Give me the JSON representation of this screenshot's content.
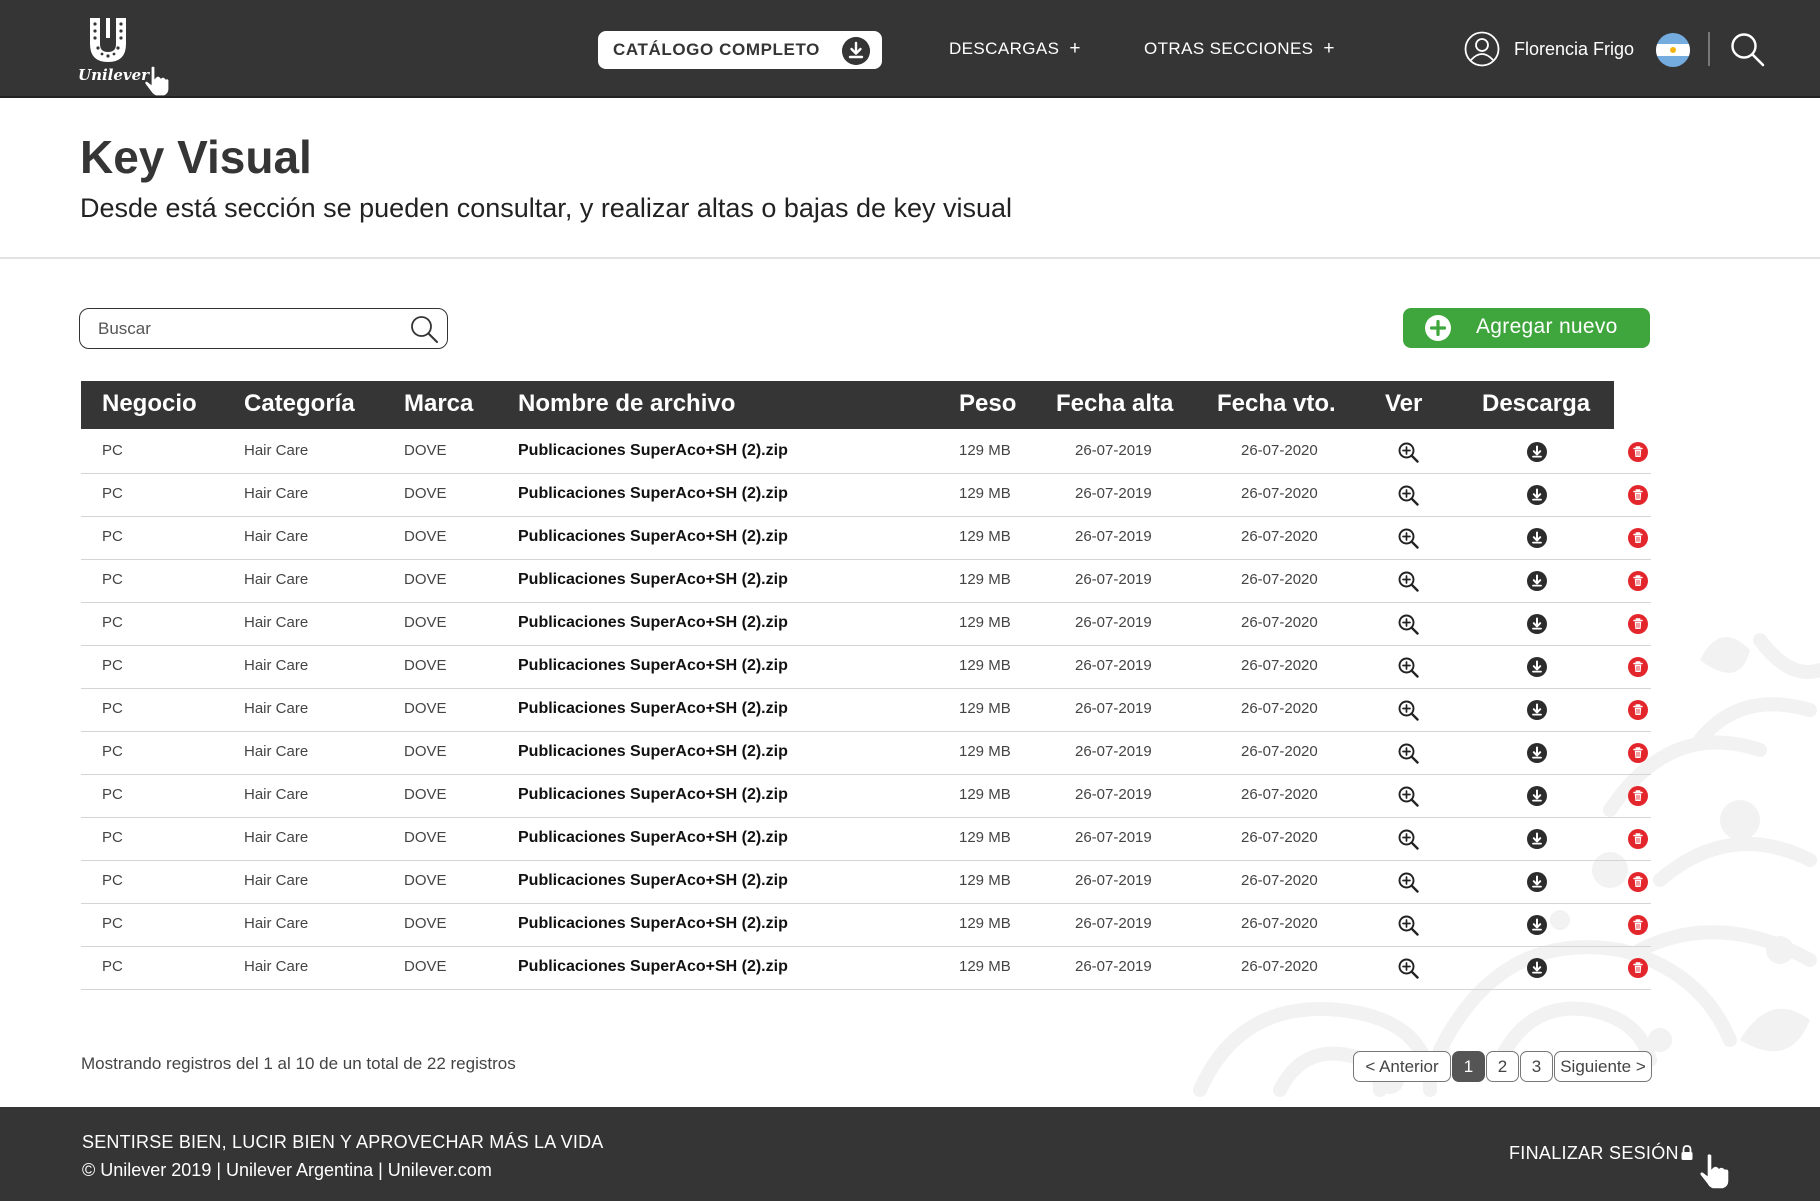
{
  "header": {
    "logo_text": "Unilever",
    "catalog_label": "CATÁLOGO COMPLETO",
    "nav": [
      {
        "label": "DESCARGAS",
        "plus": "+"
      },
      {
        "label": "OTRAS SECCIONES",
        "plus": "+"
      }
    ],
    "user_name": "Florencia Frigo"
  },
  "page": {
    "title": "Key Visual",
    "subtitle": "Desde está sección se pueden consultar, y realizar altas o bajas de key visual"
  },
  "search": {
    "placeholder": "Buscar"
  },
  "add_button": {
    "label": "Agregar nuevo"
  },
  "table": {
    "columns": [
      "Negocio",
      "Categoría",
      "Marca",
      "Nombre de archivo",
      "Peso",
      "Fecha alta",
      "Fecha vto.",
      "Ver",
      "Descarga"
    ],
    "rows": [
      [
        "PC",
        "Hair Care",
        "DOVE",
        "Publicaciones SuperAco+SH (2).zip",
        "129 MB",
        "26-07-2019",
        "26-07-2020"
      ],
      [
        "PC",
        "Hair Care",
        "DOVE",
        "Publicaciones SuperAco+SH (2).zip",
        "129 MB",
        "26-07-2019",
        "26-07-2020"
      ],
      [
        "PC",
        "Hair Care",
        "DOVE",
        "Publicaciones SuperAco+SH (2).zip",
        "129 MB",
        "26-07-2019",
        "26-07-2020"
      ],
      [
        "PC",
        "Hair Care",
        "DOVE",
        "Publicaciones SuperAco+SH (2).zip",
        "129 MB",
        "26-07-2019",
        "26-07-2020"
      ],
      [
        "PC",
        "Hair Care",
        "DOVE",
        "Publicaciones SuperAco+SH (2).zip",
        "129 MB",
        "26-07-2019",
        "26-07-2020"
      ],
      [
        "PC",
        "Hair Care",
        "DOVE",
        "Publicaciones SuperAco+SH (2).zip",
        "129 MB",
        "26-07-2019",
        "26-07-2020"
      ],
      [
        "PC",
        "Hair Care",
        "DOVE",
        "Publicaciones SuperAco+SH (2).zip",
        "129 MB",
        "26-07-2019",
        "26-07-2020"
      ],
      [
        "PC",
        "Hair Care",
        "DOVE",
        "Publicaciones SuperAco+SH (2).zip",
        "129 MB",
        "26-07-2019",
        "26-07-2020"
      ],
      [
        "PC",
        "Hair Care",
        "DOVE",
        "Publicaciones SuperAco+SH (2).zip",
        "129 MB",
        "26-07-2019",
        "26-07-2020"
      ],
      [
        "PC",
        "Hair Care",
        "DOVE",
        "Publicaciones SuperAco+SH (2).zip",
        "129 MB",
        "26-07-2019",
        "26-07-2020"
      ],
      [
        "PC",
        "Hair Care",
        "DOVE",
        "Publicaciones SuperAco+SH (2).zip",
        "129 MB",
        "26-07-2019",
        "26-07-2020"
      ],
      [
        "PC",
        "Hair Care",
        "DOVE",
        "Publicaciones SuperAco+SH (2).zip",
        "129 MB",
        "26-07-2019",
        "26-07-2020"
      ],
      [
        "PC",
        "Hair Care",
        "DOVE",
        "Publicaciones SuperAco+SH (2).zip",
        "129 MB",
        "26-07-2019",
        "26-07-2020"
      ]
    ],
    "row_icons": {
      "view": "zoom-in-icon",
      "download": "download-icon",
      "delete": "trash-icon"
    }
  },
  "records_text": "Mostrando registros del 1 al 10 de un total de 22 registros",
  "pagination": {
    "prev": "< Anterior",
    "pages": [
      "1",
      "2",
      "3"
    ],
    "active_page": "1",
    "next": "Siguiente >"
  },
  "footer": {
    "slogan": "SENTIRSE BIEN, LUCIR BIEN Y APROVECHAR MÁS LA VIDA",
    "copyright": "© Unilever 2019 | Unilever Argentina | Unilever.com",
    "logout": "FINALIZAR SESIÓN"
  },
  "colors": {
    "header_bg": "#353535",
    "accent_green": "#3fa63d",
    "delete_red": "#e3262c",
    "row_border": "#d5d5d5"
  }
}
